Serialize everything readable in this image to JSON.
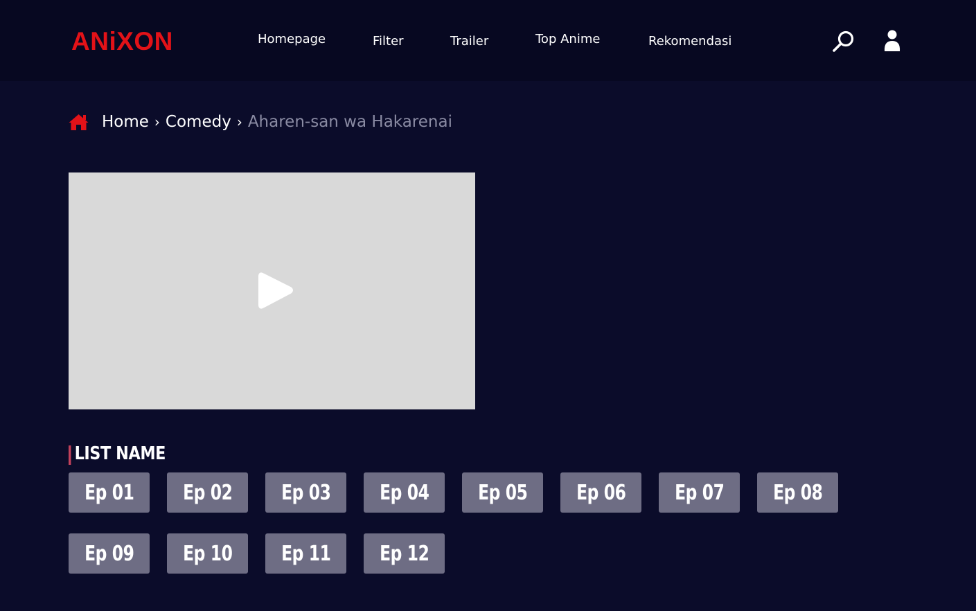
{
  "header": {
    "logo": "ANiXON",
    "nav": [
      {
        "label": "Homepage"
      },
      {
        "label": "Filter"
      },
      {
        "label": "Trailer"
      },
      {
        "label": "Top Anime"
      },
      {
        "label": "Rekomendasi"
      }
    ],
    "icons": [
      "search-icon",
      "user-icon"
    ]
  },
  "breadcrumb": {
    "home_icon": "home-icon",
    "items": [
      "Home",
      "Comedy"
    ],
    "separator": "›",
    "current": "Aharen-san wa Hakarenai"
  },
  "player": {
    "icon": "play-icon"
  },
  "episodes": {
    "title": "LIST NAME",
    "items": [
      "Ep 01",
      "Ep 02",
      "Ep 03",
      "Ep 04",
      "Ep 05",
      "Ep 06",
      "Ep 07",
      "Ep 08",
      "Ep 09",
      "Ep 10",
      "Ep 11",
      "Ep 12"
    ]
  },
  "colors": {
    "background": "#0b0c2a",
    "header_background": "#070821",
    "brand": "#e31218",
    "accent": "#c2415b",
    "episode_button": "#6e6d84",
    "player_placeholder": "#d9d9d9",
    "muted_text": "#8a8ba3"
  }
}
